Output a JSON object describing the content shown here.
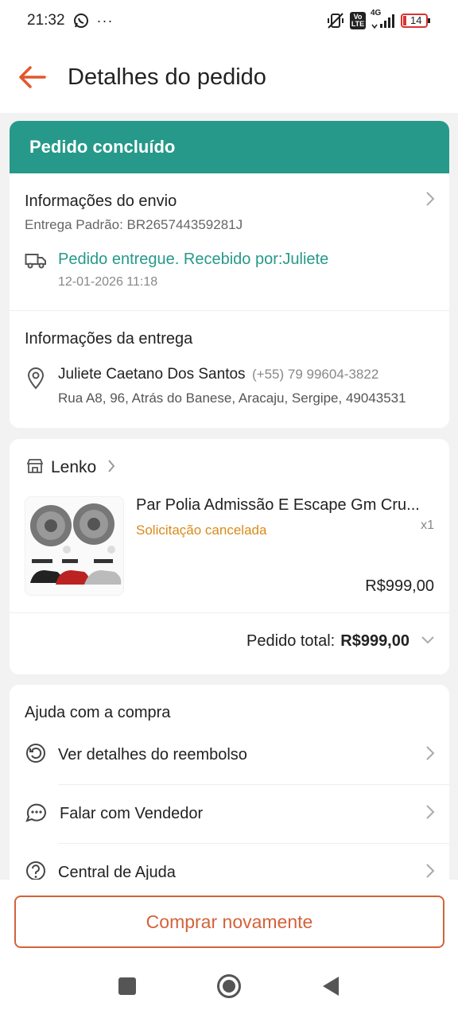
{
  "status_bar": {
    "time": "21:32",
    "more": "···",
    "network": "4G",
    "volte": "Vo LTE",
    "battery": "14"
  },
  "header": {
    "title": "Detalhes do pedido"
  },
  "order_status": {
    "banner": "Pedido concluído"
  },
  "shipping": {
    "title": "Informações do envio",
    "tracking": "Entrega Padrão: BR265744359281J",
    "status": "Pedido entregue. Recebido por:Juliete",
    "timestamp": "12-01-2026 11:18"
  },
  "delivery": {
    "title": "Informações da entrega",
    "name": "Juliete Caetano Dos Santos",
    "phone": "(+55) 79 99604-3822",
    "address": "Rua A8, 96, Atrás do Banese, Aracaju, Sergipe, 49043531"
  },
  "store": {
    "name": "Lenko"
  },
  "product": {
    "name": "Par Polia Admissão E Escape Gm Cru...",
    "status": "Solicitação cancelada",
    "quantity": "x1",
    "price": "R$999,00"
  },
  "order_total": {
    "label": "Pedido total:",
    "value": "R$999,00"
  },
  "help": {
    "title": "Ajuda com a compra",
    "items": [
      {
        "label": "Ver detalhes do reembolso"
      },
      {
        "label": "Falar com Vendedor"
      },
      {
        "label": "Central de Ajuda"
      }
    ]
  },
  "actions": {
    "buy_again": "Comprar novamente"
  },
  "colors": {
    "accent": "#d4623a",
    "teal": "#26998a",
    "warning": "#d98a1a"
  }
}
